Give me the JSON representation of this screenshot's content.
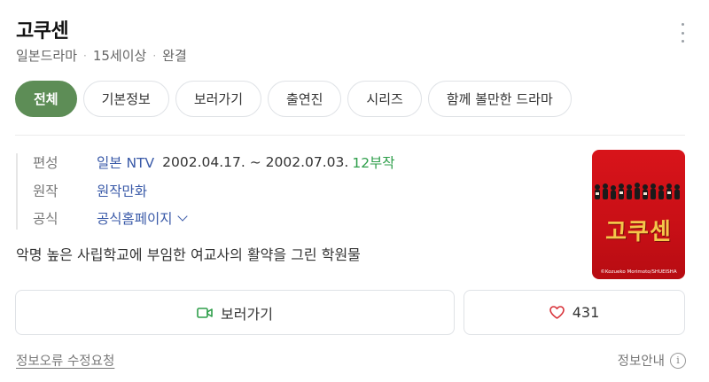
{
  "header": {
    "title": "고쿠센",
    "country": "일본드라마",
    "rating": "15세이상",
    "status": "완결"
  },
  "tabs": [
    {
      "label": "전체",
      "active": true
    },
    {
      "label": "기본정보",
      "active": false
    },
    {
      "label": "보러가기",
      "active": false
    },
    {
      "label": "출연진",
      "active": false
    },
    {
      "label": "시리즈",
      "active": false
    },
    {
      "label": "함께 볼만한 드라마",
      "active": false
    }
  ],
  "info": {
    "broadcast_label": "편성",
    "broadcast_channel": "일본 NTV",
    "broadcast_period": "2002.04.17. ~ 2002.07.03.",
    "episodes": "12부작",
    "original_label": "원작",
    "original_value": "원작만화",
    "official_label": "공식",
    "official_value": "공식홈페이지"
  },
  "description": "악명 높은 사립학교에 부임한 여교사의 활약을 그린 학원물",
  "poster": {
    "title": "고쿠센",
    "credit": "©Kozueko Morimoto/SHUEISHA"
  },
  "actions": {
    "watch_label": "보러가기",
    "like_count": "431"
  },
  "footer": {
    "report_label": "정보오류 수정요청",
    "guide_label": "정보안내",
    "guide_icon": "i"
  },
  "colors": {
    "accent_green": "#5d8d56",
    "link_blue": "#3a5aa8",
    "episode_green": "#2e9e4a",
    "heart_red": "#d8333a",
    "poster_red": "#d8141a"
  }
}
